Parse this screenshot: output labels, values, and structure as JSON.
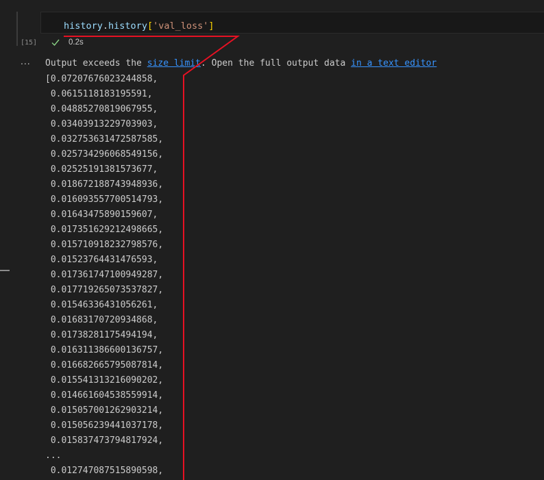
{
  "cell": {
    "execution_count": "[15]",
    "code": {
      "obj": "history",
      "dot": ".",
      "attr": "history",
      "open": "[",
      "key": "'val_loss'",
      "close": "]"
    },
    "status_icon": "check-icon",
    "duration": "0.2s"
  },
  "output": {
    "more_actions": "...",
    "notice_prefix": "Output exceeds the ",
    "size_limit_link": "size limit",
    "notice_middle": ". Open the full output data ",
    "text_editor_link": "in a text editor",
    "lines": [
      "[0.07207676023244858,",
      " 0.0615118183195591,",
      " 0.04885270819067955,",
      " 0.03403913229703903,",
      " 0.032753631472587585,",
      " 0.025734296068549156,",
      " 0.02525191381573677,",
      " 0.018672188743948936,",
      " 0.016093557700514793,",
      " 0.01643475890159607,",
      " 0.017351629212498665,",
      " 0.015710918232798576,",
      " 0.01523764431476593,",
      " 0.017361747100949287,",
      " 0.017719265073537827,",
      " 0.01546336431056261,",
      " 0.01683170720934868,",
      " 0.01738281175494194,",
      " 0.016311386600136757,",
      " 0.016682665795087814,",
      " 0.015541313216090202,",
      " 0.014661604538559914,",
      " 0.015057001262903214,",
      " 0.015056239441037178,",
      " 0.015837473794817924,",
      "...",
      " 0.012747087515890598,"
    ]
  },
  "colors": {
    "background": "#1f1f1f",
    "link": "#3794ff",
    "annotation": "#e81123",
    "success": "#89d185"
  }
}
